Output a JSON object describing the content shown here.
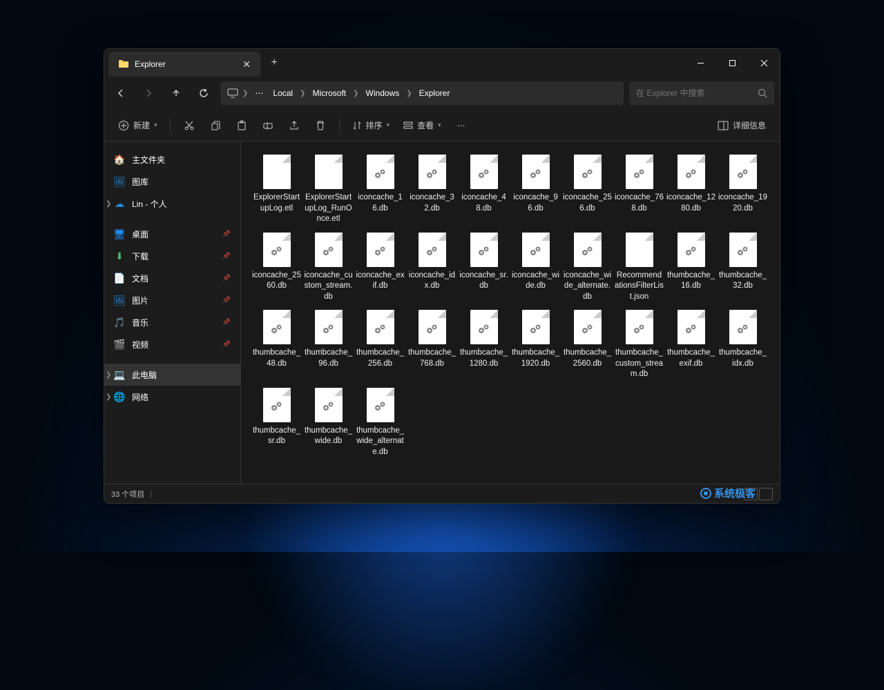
{
  "tab": {
    "title": "Explorer"
  },
  "breadcrumbs": [
    "Local",
    "Microsoft",
    "Windows",
    "Explorer"
  ],
  "search": {
    "placeholder": "在 Explorer 中搜索"
  },
  "toolbar": {
    "new": "新建",
    "sort": "排序",
    "view": "查看",
    "details": "详细信息"
  },
  "sidebar": {
    "home": "主文件夹",
    "gallery": "图库",
    "personal": "Lin - 个人",
    "desktop": "桌面",
    "downloads": "下载",
    "documents": "文档",
    "pictures": "图片",
    "music": "音乐",
    "videos": "视频",
    "thispc": "此电脑",
    "network": "网络"
  },
  "files": [
    {
      "name": "ExplorerStartupLog.etl",
      "type": "plain"
    },
    {
      "name": "ExplorerStartupLog_RunOnce.etl",
      "type": "plain"
    },
    {
      "name": "iconcache_16.db",
      "type": "gear"
    },
    {
      "name": "iconcache_32.db",
      "type": "gear"
    },
    {
      "name": "iconcache_48.db",
      "type": "gear"
    },
    {
      "name": "iconcache_96.db",
      "type": "gear"
    },
    {
      "name": "iconcache_256.db",
      "type": "gear"
    },
    {
      "name": "iconcache_768.db",
      "type": "gear"
    },
    {
      "name": "iconcache_1280.db",
      "type": "gear"
    },
    {
      "name": "iconcache_1920.db",
      "type": "gear"
    },
    {
      "name": "iconcache_2560.db",
      "type": "gear"
    },
    {
      "name": "iconcache_custom_stream.db",
      "type": "gear"
    },
    {
      "name": "iconcache_exif.db",
      "type": "gear"
    },
    {
      "name": "iconcache_idx.db",
      "type": "gear"
    },
    {
      "name": "iconcache_sr.db",
      "type": "gear"
    },
    {
      "name": "iconcache_wide.db",
      "type": "gear"
    },
    {
      "name": "iconcache_wide_alternate.db",
      "type": "gear"
    },
    {
      "name": "RecommendationsFilterList.json",
      "type": "plain"
    },
    {
      "name": "thumbcache_16.db",
      "type": "gear"
    },
    {
      "name": "thumbcache_32.db",
      "type": "gear"
    },
    {
      "name": "thumbcache_48.db",
      "type": "gear"
    },
    {
      "name": "thumbcache_96.db",
      "type": "gear"
    },
    {
      "name": "thumbcache_256.db",
      "type": "gear"
    },
    {
      "name": "thumbcache_768.db",
      "type": "gear"
    },
    {
      "name": "thumbcache_1280.db",
      "type": "gear"
    },
    {
      "name": "thumbcache_1920.db",
      "type": "gear"
    },
    {
      "name": "thumbcache_2560.db",
      "type": "gear"
    },
    {
      "name": "thumbcache_custom_stream.db",
      "type": "gear"
    },
    {
      "name": "thumbcache_exif.db",
      "type": "gear"
    },
    {
      "name": "thumbcache_idx.db",
      "type": "gear"
    },
    {
      "name": "thumbcache_sr.db",
      "type": "gear"
    },
    {
      "name": "thumbcache_wide.db",
      "type": "gear"
    },
    {
      "name": "thumbcache_wide_alternate.db",
      "type": "gear"
    }
  ],
  "status": {
    "count": "33 个项目"
  },
  "watermark": "系统极客"
}
